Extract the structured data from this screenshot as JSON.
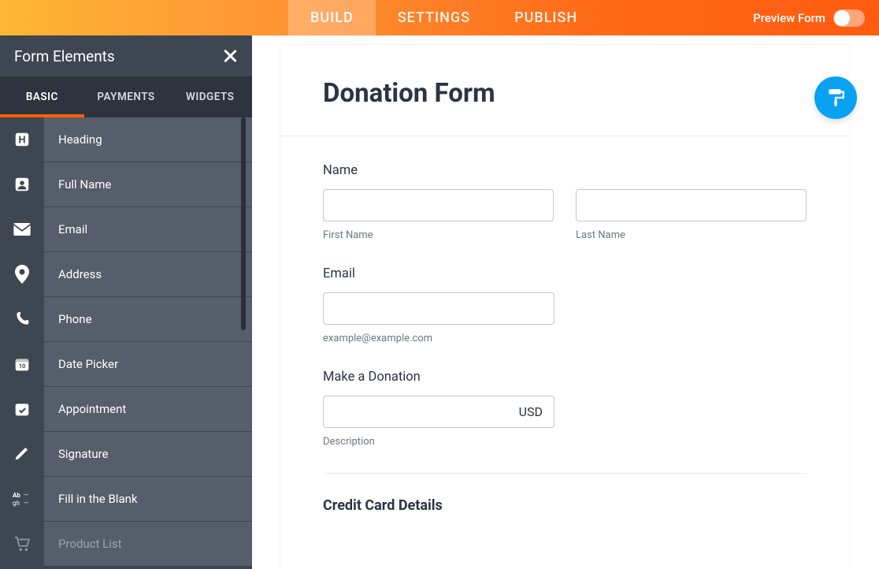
{
  "topbar": {
    "tabs": [
      {
        "label": "BUILD",
        "active": true
      },
      {
        "label": "SETTINGS",
        "active": false
      },
      {
        "label": "PUBLISH",
        "active": false
      }
    ],
    "preview_label": "Preview Form",
    "preview_on": false
  },
  "sidebar": {
    "title": "Form Elements",
    "tabs": [
      {
        "label": "BASIC",
        "active": true
      },
      {
        "label": "PAYMENTS",
        "active": false
      },
      {
        "label": "WIDGETS",
        "active": false
      }
    ],
    "elements": [
      {
        "icon": "heading-icon",
        "label": "Heading"
      },
      {
        "icon": "person-icon",
        "label": "Full Name"
      },
      {
        "icon": "email-icon",
        "label": "Email"
      },
      {
        "icon": "address-icon",
        "label": "Address"
      },
      {
        "icon": "phone-icon",
        "label": "Phone"
      },
      {
        "icon": "date-icon",
        "label": "Date Picker"
      },
      {
        "icon": "appointment-icon",
        "label": "Appointment"
      },
      {
        "icon": "signature-icon",
        "label": "Signature"
      },
      {
        "icon": "fillblank-icon",
        "label": "Fill in the Blank"
      },
      {
        "icon": "cart-icon",
        "label": "Product List",
        "muted": true
      }
    ]
  },
  "form": {
    "title": "Donation Form",
    "name": {
      "label": "Name",
      "first_sublabel": "First Name",
      "last_sublabel": "Last Name"
    },
    "email": {
      "label": "Email",
      "hint": "example@example.com"
    },
    "donation": {
      "label": "Make a Donation",
      "currency": "USD",
      "sublabel": "Description"
    },
    "cc_section": "Credit Card Details"
  },
  "fab_icon": "paint-roller-icon"
}
